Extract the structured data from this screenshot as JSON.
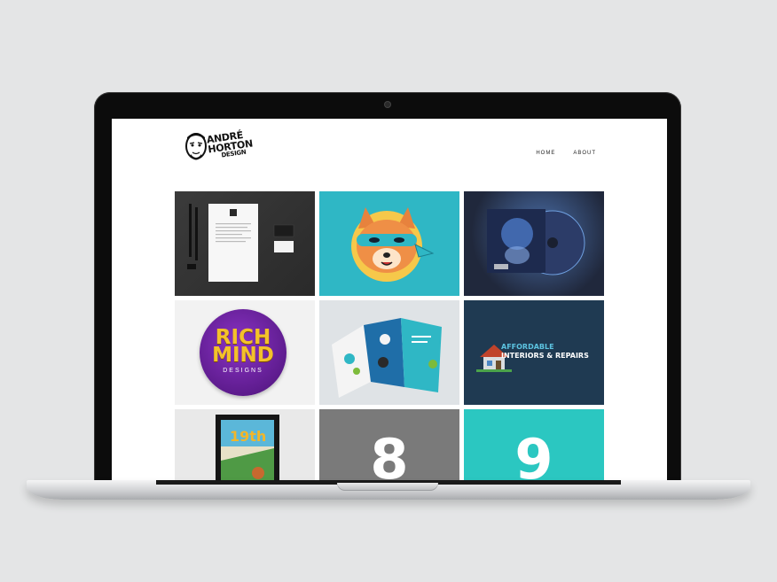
{
  "site": {
    "logo": {
      "line1": "ANDRÉ",
      "line2": "HORTON",
      "line3": "DESIGN"
    },
    "nav": [
      {
        "label": "HOME"
      },
      {
        "label": "ABOUT"
      }
    ]
  },
  "portfolio": {
    "tiles": [
      {
        "name": "stationery-mockup",
        "color": "#333333"
      },
      {
        "name": "fox-mascot",
        "color": "#2fb7c5"
      },
      {
        "name": "cd-album-art",
        "color": "#2a3450"
      },
      {
        "name": "rich-mind-designs-logo",
        "color": "#5a1a8a",
        "line1": "RICH",
        "line2": "MIND",
        "line3": "DESIGNS"
      },
      {
        "name": "trifold-brochure",
        "color": "#dfe3e6"
      },
      {
        "name": "affordable-interiors-logo",
        "color": "#1f3a52",
        "line1": "AFFORDABLE",
        "line2": "INTERIORS & REPAIRS"
      },
      {
        "name": "framed-poster",
        "color": "#e9e9e9",
        "text": "19th"
      },
      {
        "name": "placeholder-8",
        "color": "#7a7a7a",
        "number": "8"
      },
      {
        "name": "placeholder-9",
        "color": "#2bc7c1",
        "number": "9"
      }
    ]
  }
}
